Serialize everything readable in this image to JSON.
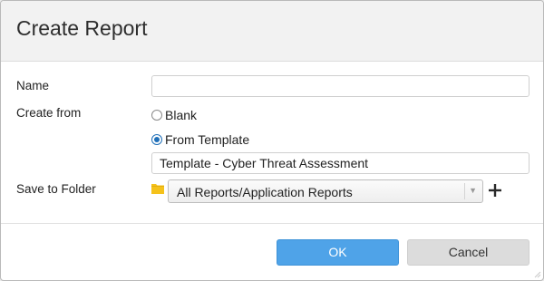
{
  "dialog": {
    "title": "Create Report"
  },
  "form": {
    "name_label": "Name",
    "name_value": "",
    "create_from_label": "Create from",
    "options": [
      {
        "label": "Blank",
        "checked": false
      },
      {
        "label": "From Template",
        "checked": true
      }
    ],
    "template_value": "Template - Cyber Threat Assessment",
    "save_to_folder_label": "Save to Folder",
    "folder_icon": "folder-icon",
    "folder_value": "All Reports/Application Reports",
    "add_icon": "plus-icon"
  },
  "buttons": {
    "ok_label": "OK",
    "cancel_label": "Cancel"
  },
  "colors": {
    "primary": "#4fa3e8",
    "radio_checked": "#1f6fb8",
    "folder": "#f5c21b"
  }
}
